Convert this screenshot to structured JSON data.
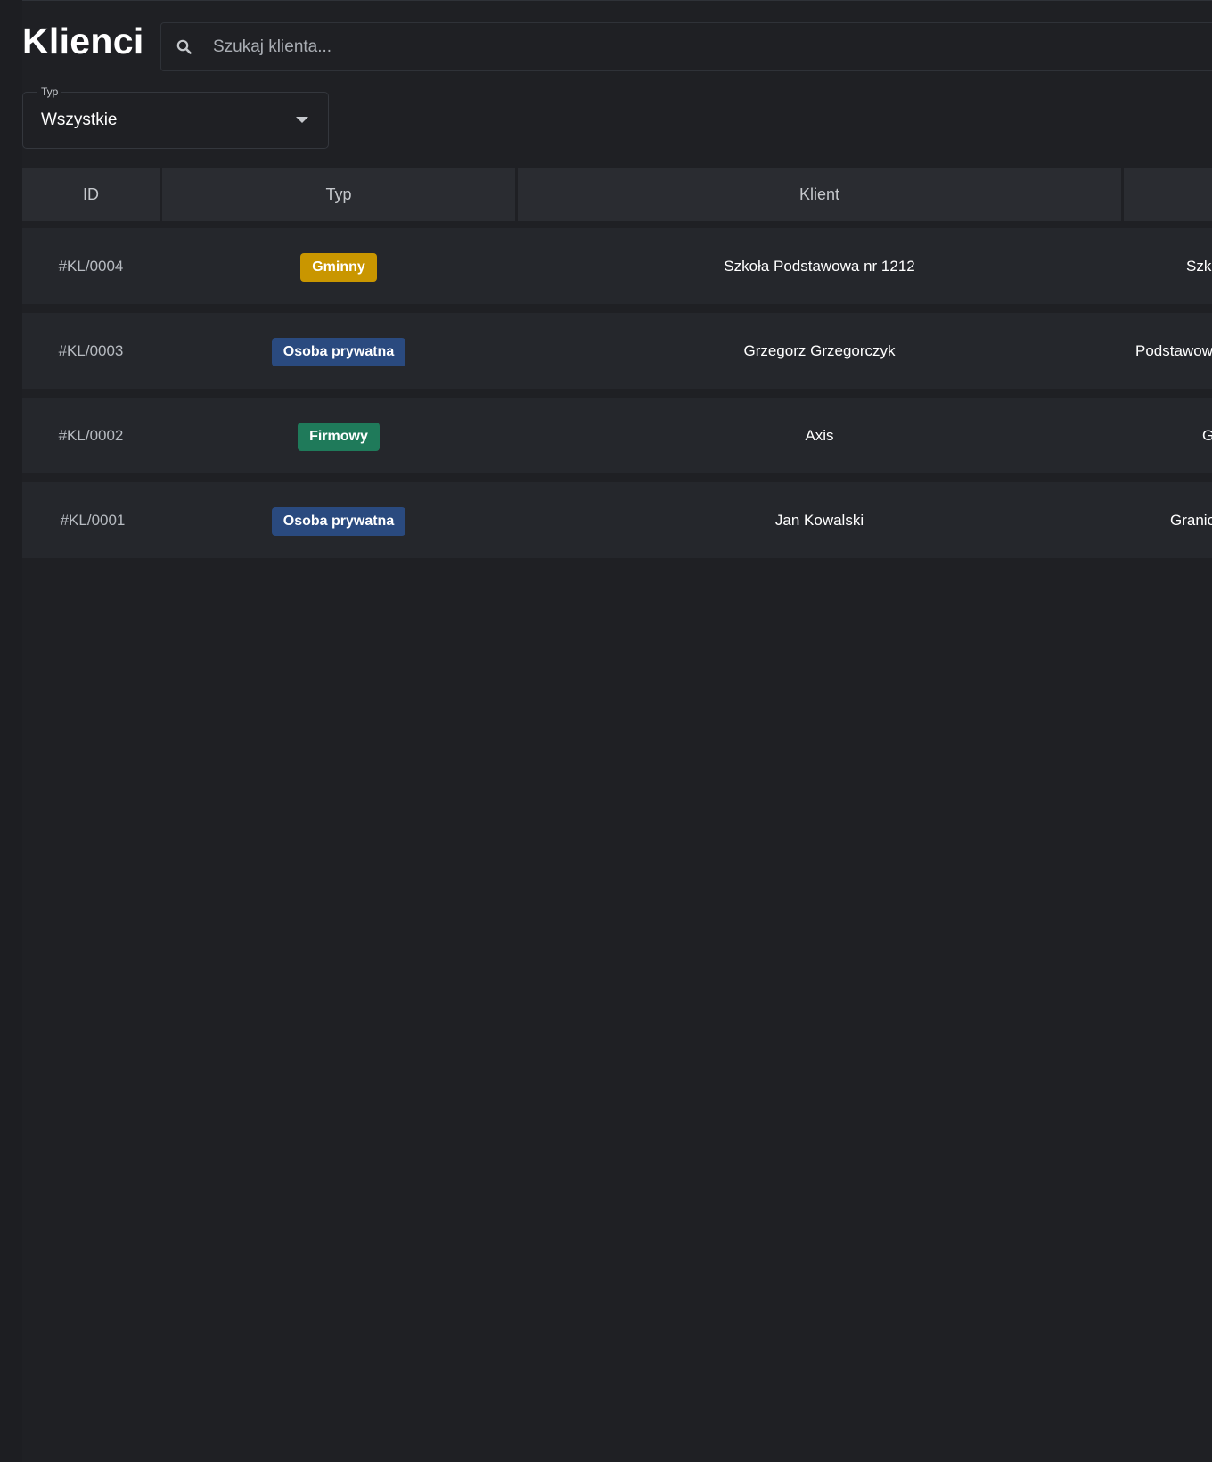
{
  "header": {
    "title": "Klienci",
    "search": {
      "placeholder": "Szukaj klienta...",
      "value": ""
    }
  },
  "filters": {
    "type": {
      "label": "Typ",
      "value": "Wszystkie"
    }
  },
  "table": {
    "columns": [
      "ID",
      "Typ",
      "Klient"
    ],
    "rows": [
      {
        "id": "#KL/0004",
        "type": "Gminny",
        "type_color": "#c99600",
        "client": "Szkoła Podstawowa nr  1212",
        "extra": "Szk"
      },
      {
        "id": "#KL/0003",
        "type": "Osoba prywatna",
        "type_color": "#2a4a7f",
        "client": "Grzegorz Grzegorczyk",
        "extra": "Podstawow"
      },
      {
        "id": "#KL/0002",
        "type": "Firmowy",
        "type_color": "#1f7a5a",
        "client": "Axis",
        "extra": "G"
      },
      {
        "id": "#KL/0001",
        "type": "Osoba prywatna",
        "type_color": "#2a4a7f",
        "client": "Jan Kowalski",
        "extra": "Granic"
      }
    ]
  },
  "colors": {
    "background": "#1f2024",
    "header_row": "#2a2c31",
    "body_row": "#25272c",
    "badge_gminny": "#c99600",
    "badge_prywatna": "#2a4a7f",
    "badge_firmowy": "#1f7a5a"
  },
  "icons": {
    "search": "search-icon",
    "dropdown": "chevron-down-icon"
  }
}
